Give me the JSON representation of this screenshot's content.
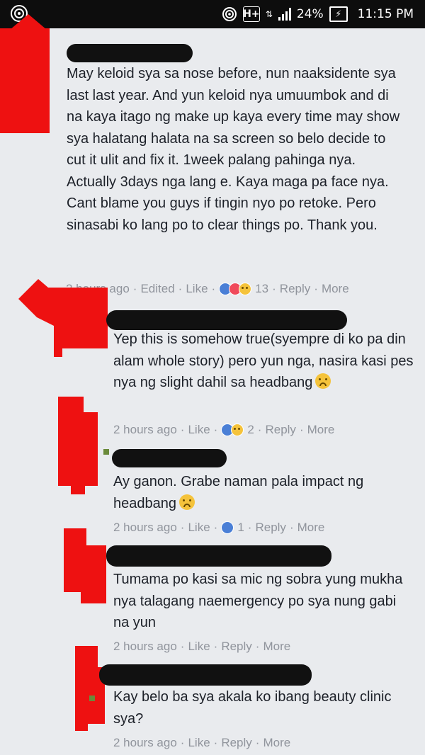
{
  "status_bar": {
    "network_type": "H+",
    "battery_percent": "24%",
    "time": "11:15 PM",
    "icons": [
      "app-notification-icon",
      "hotspot-icon",
      "network-icon",
      "signal-icon",
      "battery-charging-icon"
    ]
  },
  "colors": {
    "redaction_red": "#ee1111",
    "redaction_black": "#111111",
    "meta_gray": "#90949c",
    "like_blue": "#4a7fd6",
    "love_red": "#f04a5b",
    "sad_yellow": "#f5c33b"
  },
  "comments": [
    {
      "text": "May keloid sya sa nose before, nun naaksidente sya last last year. And yun keloid nya umuumbok and di na kaya itago ng make up kaya every time may show sya halatang halata na sa screen so belo decide to cut it ulit and fix it. 1week palang pahinga nya. Actually 3days nga lang e. Kaya maga pa face nya. Cant blame you guys if tingin nyo po retoke. Pero sinasabi ko lang po to clear things po. Thank you.",
      "time": "2 hours ago",
      "edited": "Edited",
      "like": "Like",
      "reactions": [
        "like",
        "love",
        "sad"
      ],
      "reaction_count": "13",
      "reply": "Reply",
      "more": "More"
    },
    {
      "text": "Yep this is somehow true(syempre di ko pa din alam whole story) pero yun nga, nasira kasi pes nya ng slight dahil sa headbang",
      "emoji": "sad-face-emoji",
      "time": "2 hours ago",
      "like": "Like",
      "reactions": [
        "like",
        "sad"
      ],
      "reaction_count": "2",
      "reply": "Reply",
      "more": "More"
    },
    {
      "text": "Ay ganon. Grabe naman pala impact ng headbang",
      "emoji": "sad-face-emoji",
      "time": "2 hours ago",
      "like": "Like",
      "reactions": [
        "like"
      ],
      "reaction_count": "1",
      "reply": "Reply",
      "more": "More"
    },
    {
      "text": "Tumama po kasi sa mic ng sobra yung mukha nya talagang naemergency po sya nung gabi na yun",
      "time": "2 hours ago",
      "like": "Like",
      "reply": "Reply",
      "more": "More"
    },
    {
      "text": "Kay belo ba sya akala ko ibang beauty clinic sya?",
      "time": "2 hours ago",
      "like": "Like",
      "reply": "Reply",
      "more": "More"
    }
  ]
}
